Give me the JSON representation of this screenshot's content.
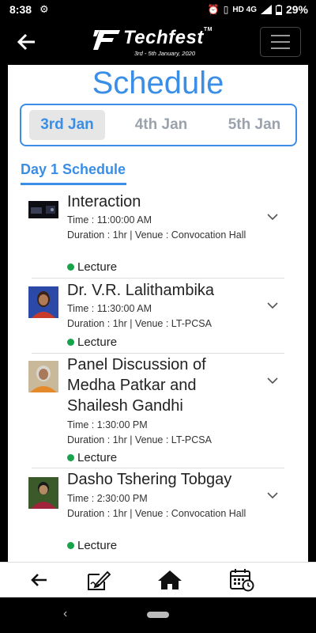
{
  "status_bar": {
    "time": "8:38",
    "network": "HD 4G",
    "battery": "29%"
  },
  "header": {
    "brand": "Techfest",
    "tm": "TM",
    "tagline": "3rd - 5th January, 2020"
  },
  "page": {
    "title": "Schedule"
  },
  "date_tabs": [
    {
      "label": "3rd Jan",
      "active": true
    },
    {
      "label": "4th Jan",
      "active": false
    },
    {
      "label": "5th Jan",
      "active": false
    }
  ],
  "day_heading": "Day 1 Schedule",
  "events": [
    {
      "title": "Interaction",
      "time": "Time : 11:00:00 AM",
      "details": "Duration : 1hr | Venue : Convocation Hall",
      "category": "Lecture"
    },
    {
      "title": "Dr. V.R. Lalithambika",
      "time": "Time : 11:30:00 AM",
      "details": "Duration : 1hr | Venue : LT-PCSA",
      "category": "Lecture"
    },
    {
      "title": "Panel Discussion of Medha Patkar and Shailesh Gandhi",
      "time": "Time : 1:30:00 PM",
      "details": "Duration : 1hr | Venue : LT-PCSA",
      "category": "Lecture"
    },
    {
      "title": "Dasho Tshering Tobgay",
      "time": "Time : 2:30:00 PM",
      "details": "Duration : 1hr | Venue : Convocation Hall",
      "category": "Lecture"
    }
  ],
  "colors": {
    "accent": "#3a8ee6",
    "category_dot": "#16a34a"
  },
  "icons": {
    "back": "arrow-left-icon",
    "menu": "hamburger-menu-icon",
    "expand": "chevron-down-icon",
    "nav_back": "arrow-left-icon",
    "nav_register": "edit-note-icon",
    "nav_home": "home-icon",
    "nav_schedule": "calendar-clock-icon"
  }
}
